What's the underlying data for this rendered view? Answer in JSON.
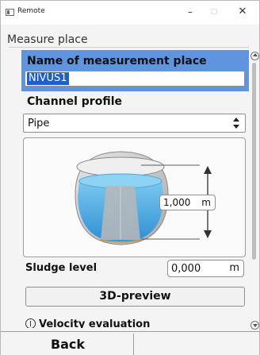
{
  "window": {
    "title": "Remote",
    "minimize_glyph": "–",
    "maximize_glyph": "□",
    "close_glyph": "✕"
  },
  "section": {
    "title": "Measure place"
  },
  "measurement_place": {
    "label": "Name of measurement place",
    "value": "NIVUS1"
  },
  "channel_profile": {
    "label": "Channel profile",
    "selected": "Pipe"
  },
  "pipe_preview": {
    "fill_level_value": "1,000",
    "fill_level_unit": "m",
    "colors": {
      "pipe_outer": "#d4d4d4",
      "pipe_inner": "#c8c8c8",
      "water": "#3f9fde",
      "water_light": "#6ec0ee",
      "dimension_line": "#5a5a5a"
    }
  },
  "sludge": {
    "label": "Sludge level",
    "value": "0,000",
    "unit": "m"
  },
  "preview_button": {
    "label": "3D-preview"
  },
  "velocity": {
    "label": "Velocity evaluation"
  },
  "footer": {
    "back_label": "Back"
  },
  "colors": {
    "selection_band": "#5f95de",
    "text_selection": "#1d5fd1"
  }
}
